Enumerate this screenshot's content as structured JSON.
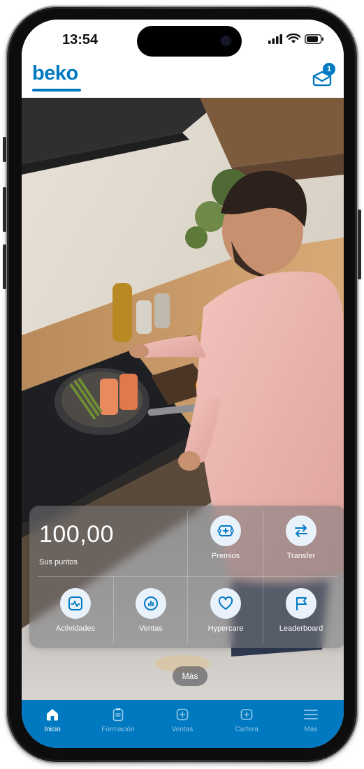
{
  "status_bar": {
    "time": "13:54"
  },
  "header": {
    "logo": "beko",
    "notification_count": "1"
  },
  "points": {
    "value": "100,00",
    "label": "Sus puntos"
  },
  "actions": [
    {
      "label": "Premios",
      "icon": "gift-card-icon"
    },
    {
      "label": "Transfer",
      "icon": "transfer-arrows-icon"
    },
    {
      "label": "Actividades",
      "icon": "activity-chart-icon"
    },
    {
      "label": "Ventas",
      "icon": "bar-chart-icon"
    },
    {
      "label": "Hypercare",
      "icon": "heart-icon"
    },
    {
      "label": "Leaderboard",
      "icon": "flag-icon"
    }
  ],
  "more_button": "Más",
  "tabs": [
    {
      "label": "Inicio",
      "icon": "home-icon",
      "active": true
    },
    {
      "label": "Formación",
      "icon": "clipboard-icon",
      "active": false
    },
    {
      "label": "Ventas",
      "icon": "plus-square-icon",
      "active": false
    },
    {
      "label": "Cartera",
      "icon": "wallet-icon",
      "active": false
    },
    {
      "label": "Más",
      "icon": "menu-icon",
      "active": false
    }
  ],
  "colors": {
    "brand_blue": "#0079c1",
    "tile_bg": "#e9f2fb"
  }
}
